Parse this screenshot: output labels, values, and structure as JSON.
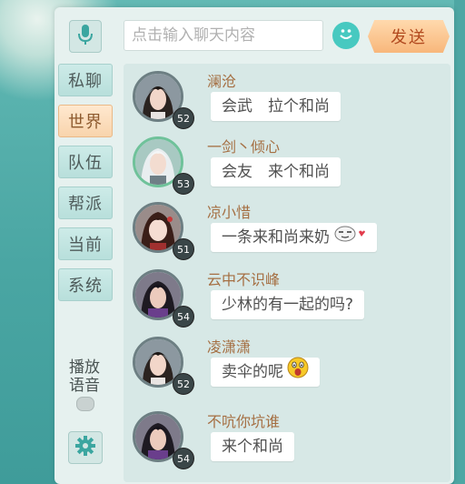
{
  "colors": {
    "accent": "#f8b77b",
    "panel_bg": "#e6f1ef",
    "name_color": "#a56f43",
    "active_tab": "#ffe8cf"
  },
  "input": {
    "placeholder": "点击输入聊天内容"
  },
  "send_button": "发送",
  "tabs": [
    {
      "label": "私聊",
      "active": false
    },
    {
      "label": "世界",
      "active": true
    },
    {
      "label": "队伍",
      "active": false
    },
    {
      "label": "帮派",
      "active": false
    },
    {
      "label": "当前",
      "active": false
    },
    {
      "label": "系统",
      "active": false
    }
  ],
  "voice": {
    "label_line1": "播放",
    "label_line2": "语音"
  },
  "icons": {
    "mic": "microphone-icon",
    "settings": "gear-icon",
    "emoji": "smiley-icon"
  },
  "messages": [
    {
      "name": "澜沧",
      "level": "52",
      "text": "会武　拉个和尚",
      "emoji": ""
    },
    {
      "name": "一剑丶倾心",
      "level": "53",
      "text": "会友　来个和尚",
      "emoji": ""
    },
    {
      "name": "凉小惜",
      "level": "51",
      "text": "一条来和尚来奶",
      "emoji": "shy-face"
    },
    {
      "name": "云中不识峰",
      "level": "54",
      "text": "少林的有一起的吗?",
      "emoji": ""
    },
    {
      "name": "凌潇潇",
      "level": "52",
      "text": "卖伞的呢",
      "emoji": "shocked-face"
    },
    {
      "name": "不吭你坑谁",
      "level": "54",
      "text": "来个和尚",
      "emoji": ""
    }
  ]
}
